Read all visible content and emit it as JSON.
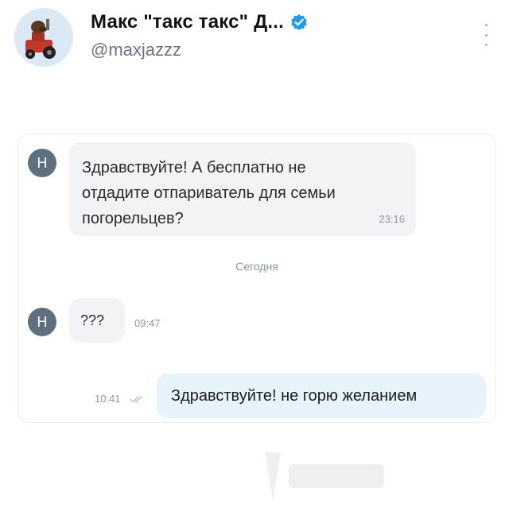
{
  "post": {
    "author_name": "Макс \"такс такс\" Д...",
    "handle": "@maxjazzz"
  },
  "icons": {
    "verified": "verified-badge-icon",
    "more": "more-vertical-icon",
    "read": "double-check-icon"
  },
  "colors": {
    "accent": "#1d9bf0",
    "incoming_bubble": "#f2f3f5",
    "outgoing_bubble": "#e7f3fb",
    "avatar_bg": "#5e6f80"
  },
  "chat": {
    "messages": [
      {
        "direction": "incoming",
        "avatar_letter": "Н",
        "text_lines": [
          "Здравствуйте! А бесплатно не",
          "отдадите отпариватель для семьи",
          "погорельцев?"
        ],
        "time": "23:16"
      },
      {
        "direction": "incoming",
        "avatar_letter": "Н",
        "text": "???",
        "time": "09:47"
      },
      {
        "direction": "outgoing",
        "text": "Здравствуйте! не горю желанием",
        "time": "10:41"
      }
    ],
    "date_separator": "Сегодня"
  }
}
